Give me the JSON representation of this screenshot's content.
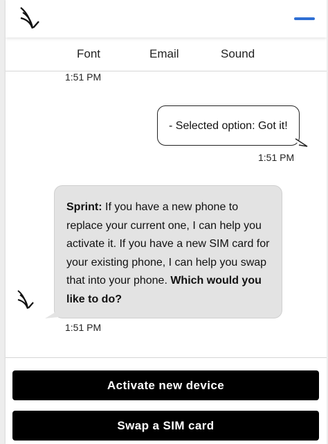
{
  "header": {
    "logo_icon": "sprint-logo-icon",
    "menu_icon": "menu-line-icon",
    "accent_color": "#2f6fd4"
  },
  "tabs": [
    {
      "label": "Font"
    },
    {
      "label": "Email"
    },
    {
      "label": "Sound"
    }
  ],
  "chat": {
    "timestamps": [
      "1:51 PM",
      "1:51 PM",
      "1:51 PM"
    ],
    "user_message": "- Selected option: Got it!",
    "bot_message": {
      "sender": "Sprint:",
      "text": " If you have a new phone to replace your current one, I can help you activate it. If you have a new SIM card for your existing phone, I can help you swap that into your phone. ",
      "question": "Which would you like to do?"
    }
  },
  "actions": [
    {
      "label": "Activate new device"
    },
    {
      "label": "Swap a SIM card"
    }
  ]
}
